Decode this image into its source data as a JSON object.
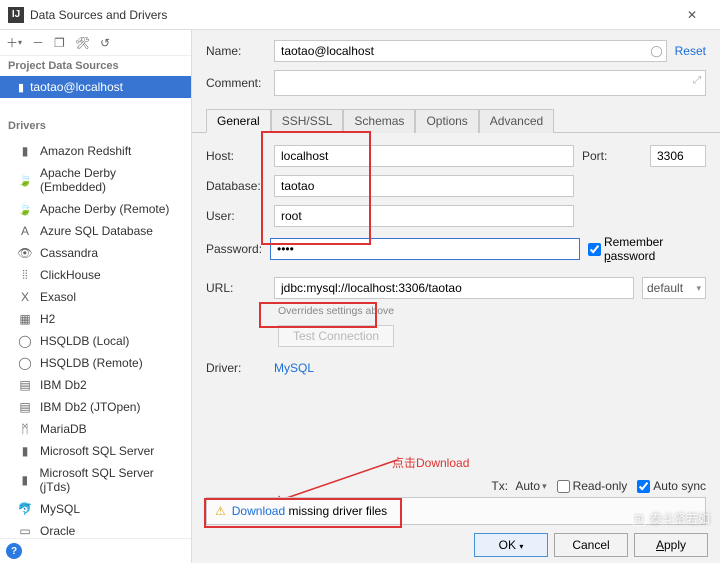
{
  "window": {
    "title": "Data Sources and Drivers"
  },
  "left": {
    "project_header": "Project Data Sources",
    "selected": "taotao@localhost",
    "drivers_header": "Drivers",
    "drivers": [
      "Amazon Redshift",
      "Apache Derby (Embedded)",
      "Apache Derby (Remote)",
      "Azure SQL Database",
      "Cassandra",
      "ClickHouse",
      "Exasol",
      "H2",
      "HSQLDB (Local)",
      "HSQLDB (Remote)",
      "IBM Db2",
      "IBM Db2 (JTOpen)",
      "MariaDB",
      "Microsoft SQL Server",
      "Microsoft SQL Server (jTds)",
      "MySQL",
      "Oracle"
    ]
  },
  "form": {
    "name_label": "Name:",
    "name_value": "taotao@localhost",
    "reset": "Reset",
    "comment_label": "Comment:",
    "tabs": [
      "General",
      "SSH/SSL",
      "Schemas",
      "Options",
      "Advanced"
    ],
    "host_label": "Host:",
    "host_value": "localhost",
    "port_label": "Port:",
    "port_value": "3306",
    "database_label": "Database:",
    "database_value": "taotao",
    "user_label": "User:",
    "user_value": "root",
    "password_label": "Password:",
    "password_value": "••••",
    "remember_html": "Remember password",
    "remember_u": "p",
    "url_label": "URL:",
    "url_value": "jdbc:mysql://localhost:3306/taotao",
    "url_mode": "default",
    "overrides": "Overrides settings above",
    "test_connection": "Test Connection",
    "driver_label": "Driver:",
    "driver_name": "MySQL",
    "tx_label": "Tx:",
    "tx_value": "Auto",
    "readonly_label": "Read-only",
    "autosync_label": "Auto sync",
    "download_link": "Download",
    "download_rest": " missing driver files",
    "annotation": "点击Download"
  },
  "buttons": {
    "ok": "OK",
    "cancel": "Cancel",
    "apply": "Apply"
  },
  "watermark": "泰斗贤若如"
}
